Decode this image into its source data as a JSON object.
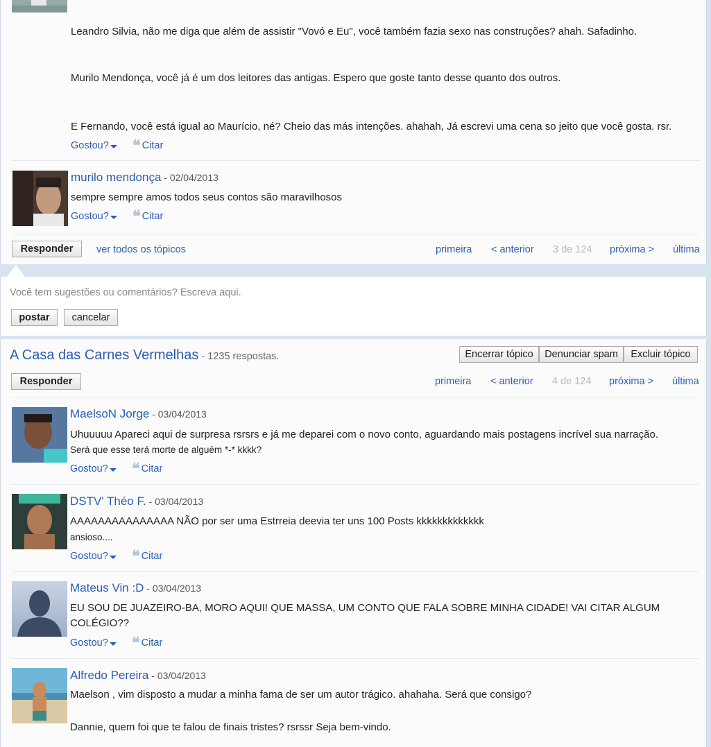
{
  "posts_top": {
    "paragraph1": "Leandro Silvia, não me diga que além de assistir \"Vovó e Eu\", você também fazia sexo nas construções? ahah. Safadinho.",
    "paragraph2": "Murilo Mendonça, você já é um  dos leitores das antigas. Espero que goste tanto desse quanto dos outros.",
    "paragraph3": "E Fernando, você está igual ao Maurício, né? Cheio das más intenções. ahahah, Já escrevi uma cena so jeito que você gosta. rsr.",
    "post2": {
      "author": "murilo mendonça",
      "date": " - 02/04/2013",
      "text": "sempre sempre amos todos seus contos são maravilhosos"
    }
  },
  "actions": {
    "gostou": "Gostou?",
    "citar": "Citar"
  },
  "topic1_footer": {
    "reply": "Responder",
    "all_topics": "ver todos os tópicos",
    "first": "primeira",
    "prev": "< anterior",
    "page": "3 de 124",
    "next": "próxima >",
    "last": "última"
  },
  "comment_box": {
    "prompt": "Você tem sugestões ou comentários? Escreva aqui.",
    "post": "postar",
    "cancel": "cancelar"
  },
  "topic2": {
    "title": "A Casa das Carnes Vermelhas",
    "count": " - 1235 respostas.",
    "close": "Encerrar tópico",
    "spam": "Denunciar spam",
    "delete": "Excluir tópico",
    "reply": "Responder",
    "first": "primeira",
    "prev": "< anterior",
    "page": "4 de 124",
    "next": "próxima >",
    "last": "última",
    "posts": [
      {
        "author": "MaelsoN Jorge",
        "date": " - 03/04/2013",
        "line1": "Uhuuuuu Apareci aqui de surpresa rsrsrs e já me deparei com o novo conto, aguardando mais postagens incrível sua narração.",
        "line2": "Será que esse terá morte de alguém *-* kkkk?"
      },
      {
        "author": "DSTV' Théo F.",
        "date": " - 03/04/2013",
        "line1": "AAAAAAAAAAAAAAA  NÃO por ser uma Estrreia deevia ter uns 100 Posts kkkkkkkkkkkkk",
        "line2": "ansioso...."
      },
      {
        "author": "Mateus Vin :D",
        "date": " - 03/04/2013",
        "line1": "EU SOU DE JUAZEIRO-BA, MORO AQUI! QUE MASSA, UM CONTO QUE FALA SOBRE MINHA CIDADE! VAI CITAR ALGUM",
        "line2": "COLÉGIO??"
      },
      {
        "author": "Alfredo Pereira",
        "date": " - 03/04/2013",
        "line1": "Maelson , vim disposto a mudar a minha fama de ser um autor trágico. ahahaha. Será que consigo?",
        "line2": "Dannie, quem foi que te falou de finais tristes? rsrssr Seja bem-vindo."
      }
    ]
  }
}
